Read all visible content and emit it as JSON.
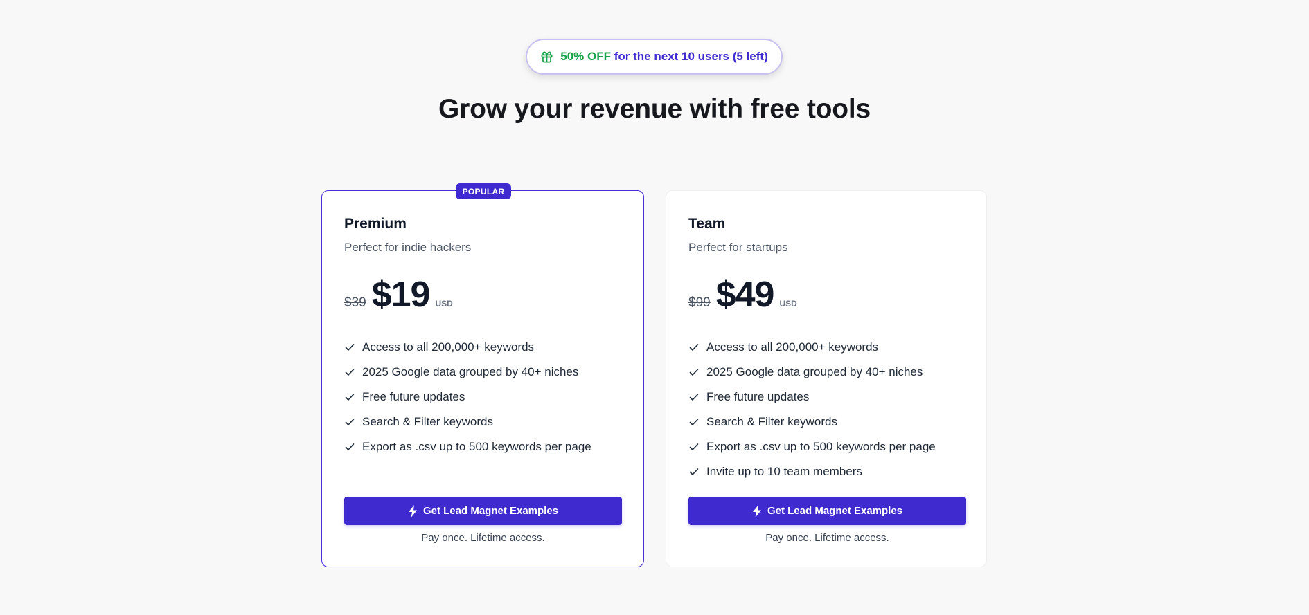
{
  "promo": {
    "highlight": "50% OFF",
    "rest": "for the next 10 users (5 left)",
    "icon": "gift-icon"
  },
  "headline": "Grow your revenue with free tools",
  "colors": {
    "accent": "#3f2ad0",
    "promo_green": "#16a34a",
    "background": "#f8f8f8"
  },
  "plans": [
    {
      "badge": "POPULAR",
      "name": "Premium",
      "description": "Perfect for indie hackers",
      "old_price": "$39",
      "price": "$19",
      "currency": "USD",
      "features": [
        "Access to all 200,000+ keywords",
        "2025 Google data grouped by 40+ niches",
        "Free future updates",
        "Search & Filter keywords",
        "Export as .csv up to 500 keywords per page"
      ],
      "cta_label": "Get Lead Magnet Examples",
      "cta_icon": "lightning-icon",
      "note": "Pay once. Lifetime access."
    },
    {
      "name": "Team",
      "description": "Perfect for startups",
      "old_price": "$99",
      "price": "$49",
      "currency": "USD",
      "features": [
        "Access to all 200,000+ keywords",
        "2025 Google data grouped by 40+ niches",
        "Free future updates",
        "Search & Filter keywords",
        "Export as .csv up to 500 keywords per page",
        "Invite up to 10 team members"
      ],
      "cta_label": "Get Lead Magnet Examples",
      "cta_icon": "lightning-icon",
      "note": "Pay once. Lifetime access."
    }
  ]
}
